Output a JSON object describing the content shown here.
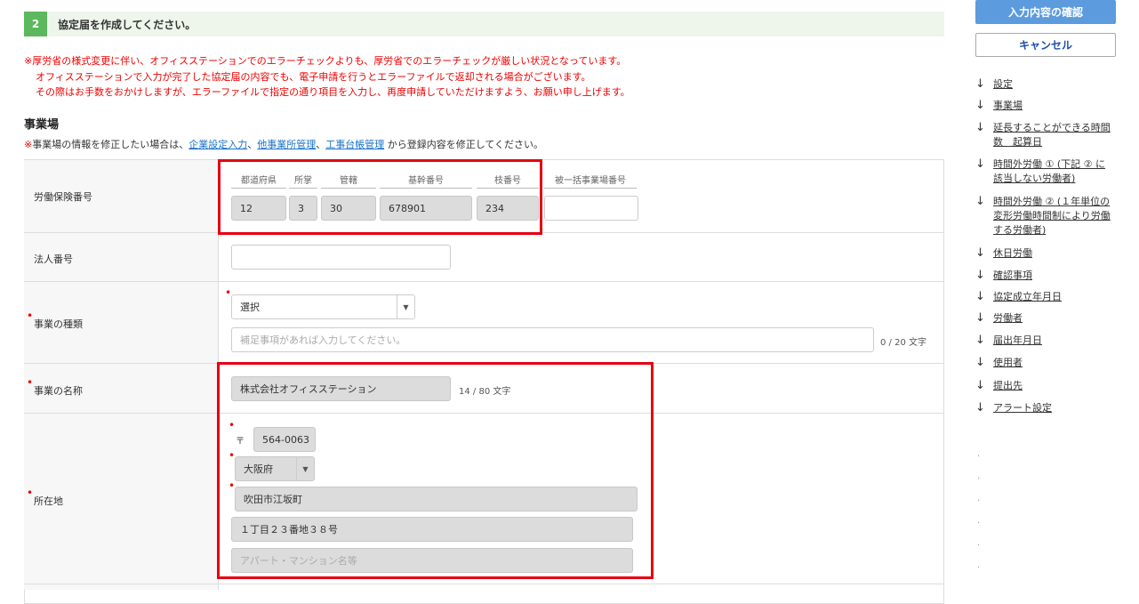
{
  "step": {
    "number": "2",
    "title": "協定届を作成してください。"
  },
  "notice": {
    "mark": "※",
    "line1": "厚労省の様式変更に伴い、オフィスステーションでのエラーチェックよりも、厚労省でのエラーチェックが厳しい状況となっています。",
    "line2": "オフィスステーションで入力が完了した協定届の内容でも、電子申請を行うとエラーファイルで返却される場合がございます。",
    "line3": "その際はお手数をおかけしますが、エラーファイルで指定の通り項目を入力し、再度申請していただけますよう、お願い申し上げます。"
  },
  "section": {
    "title": "事業場",
    "note_mark": "※",
    "note_prefix": "事業場の情報を修正したい場合は、",
    "link1": "企業設定入力",
    "sep1": "、",
    "link2": "他事業所管理",
    "sep2": "、",
    "link3": "工事台帳管理",
    "note_suffix": " から登録内容を修正してください。"
  },
  "rows": {
    "insurance": {
      "label": "労働保険番号",
      "headers": [
        "都道府県",
        "所掌",
        "管轄",
        "基幹番号",
        "枝番号",
        "被一括事業場番号"
      ],
      "values": [
        "12",
        "3",
        "30",
        "678901",
        "234",
        ""
      ]
    },
    "corp_number": {
      "label": "法人番号",
      "value": ""
    },
    "business_type": {
      "label": "事業の種類",
      "select_value": "選択",
      "supplement_placeholder": "補足事項があれば入力してください。",
      "counter": "0 / 20 文字"
    },
    "business_name": {
      "label": "事業の名称",
      "value": "株式会社オフィスステーション",
      "counter": "14 / 80 文字"
    },
    "address": {
      "label": "所在地",
      "postal_mark": "〒",
      "postal": "564-0063",
      "prefecture": "大阪府",
      "city": "吹田市江坂町",
      "street": "１丁目２３番地３８号",
      "building_placeholder": "アパート・マンション名等"
    }
  },
  "sidebar": {
    "confirm_button": "入力内容の確認",
    "cancel_button": "キャンセル",
    "arrow": "↓",
    "nav": [
      "設定",
      "事業場",
      "延長することができる時間数　起算日",
      "時間外労働 ① (下記 ② に該当しない労働者)",
      "時間外労働 ② (１年単位の変形労働時間制により労働する労働者)",
      "休日労働",
      "確認事項",
      "協定成立年月日",
      "労働者",
      "届出年月日",
      "使用者",
      "提出先",
      "アラート設定"
    ]
  },
  "colors": {
    "accent": "#5cb85c",
    "highlight": "#e50012",
    "link": "#1a73c8",
    "confirm_bg": "#5b9bde"
  }
}
